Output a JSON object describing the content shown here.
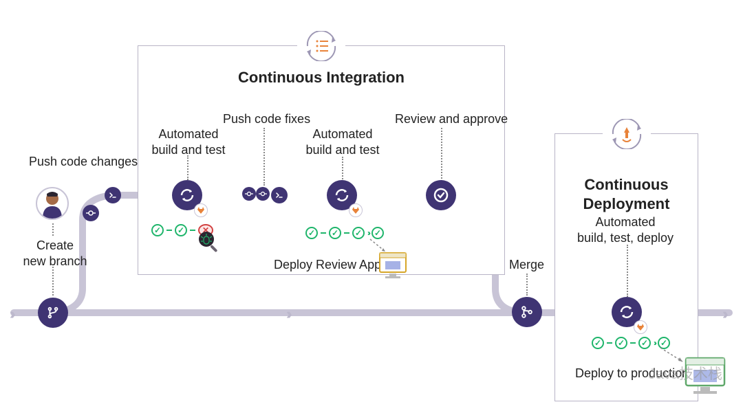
{
  "sections": {
    "ci": {
      "title": "Continuous Integration"
    },
    "cd": {
      "title": "Continuous Deployment"
    }
  },
  "labels": {
    "create_branch": "Create\nnew branch",
    "push_changes": "Push code changes",
    "auto_build_test_1": "Automated\nbuild and test",
    "push_fixes": "Push code fixes",
    "auto_build_test_2": "Automated\nbuild and test",
    "review_approve": "Review and approve",
    "deploy_review": "Deploy Review App",
    "merge": "Merge",
    "auto_btd": "Automated\nbuild, test, deploy",
    "deploy_prod": "Deploy to production"
  },
  "colors": {
    "node": "#3f3473",
    "ok": "#1fb56b",
    "fail": "#d24040",
    "pipe": "#c8c4d6"
  },
  "watermark": "Java技术栈"
}
